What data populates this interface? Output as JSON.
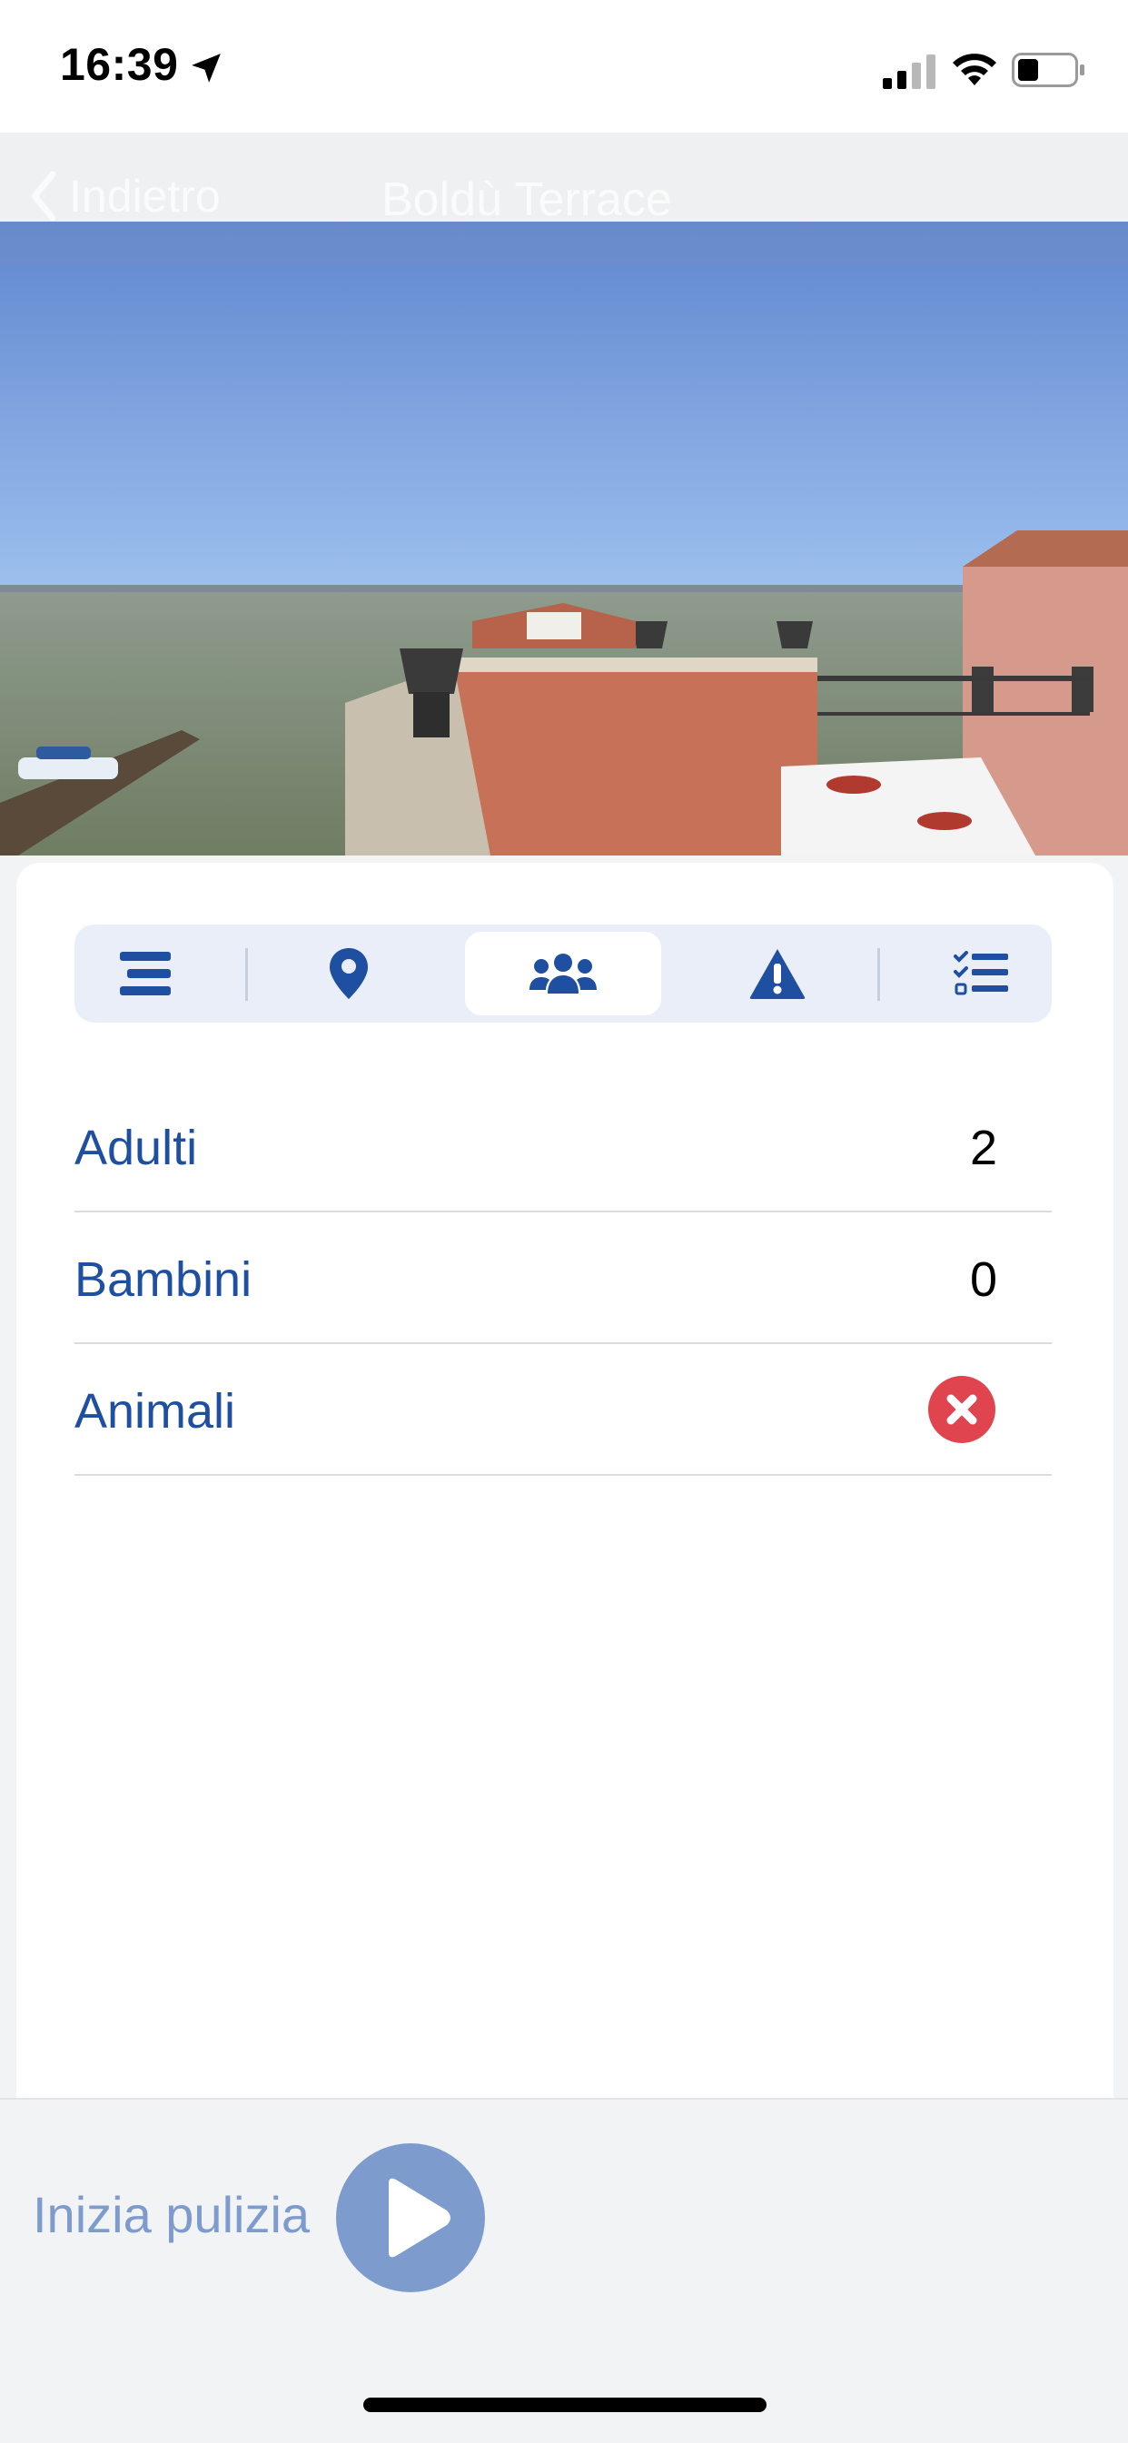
{
  "status_bar": {
    "time": "16:39",
    "icons": [
      "location-arrow-icon",
      "cellular-signal-icon",
      "wifi-icon",
      "battery-icon"
    ]
  },
  "nav": {
    "back_label": "Indietro",
    "title": "Boldù Terrace"
  },
  "hero": {
    "description_icon": "property-photo"
  },
  "tabs": [
    {
      "icon": "description-lines-icon",
      "active": false
    },
    {
      "icon": "map-pin-icon",
      "active": false
    },
    {
      "icon": "users-group-icon",
      "active": true
    },
    {
      "icon": "warning-triangle-icon",
      "active": false
    },
    {
      "icon": "checklist-icon",
      "active": false
    }
  ],
  "guests": {
    "rows": [
      {
        "label": "Adulti",
        "value": "2"
      },
      {
        "label": "Bambini",
        "value": "0"
      },
      {
        "label": "Animali",
        "value_icon": "not-allowed-icon"
      }
    ]
  },
  "bottom": {
    "start_label": "Inizia pulizia",
    "start_icon": "play-icon"
  },
  "colors": {
    "primary": "#1f4fa0",
    "primary_muted": "#7e9bce",
    "tab_bg": "#e9eef8",
    "negative": "#e0454f"
  }
}
